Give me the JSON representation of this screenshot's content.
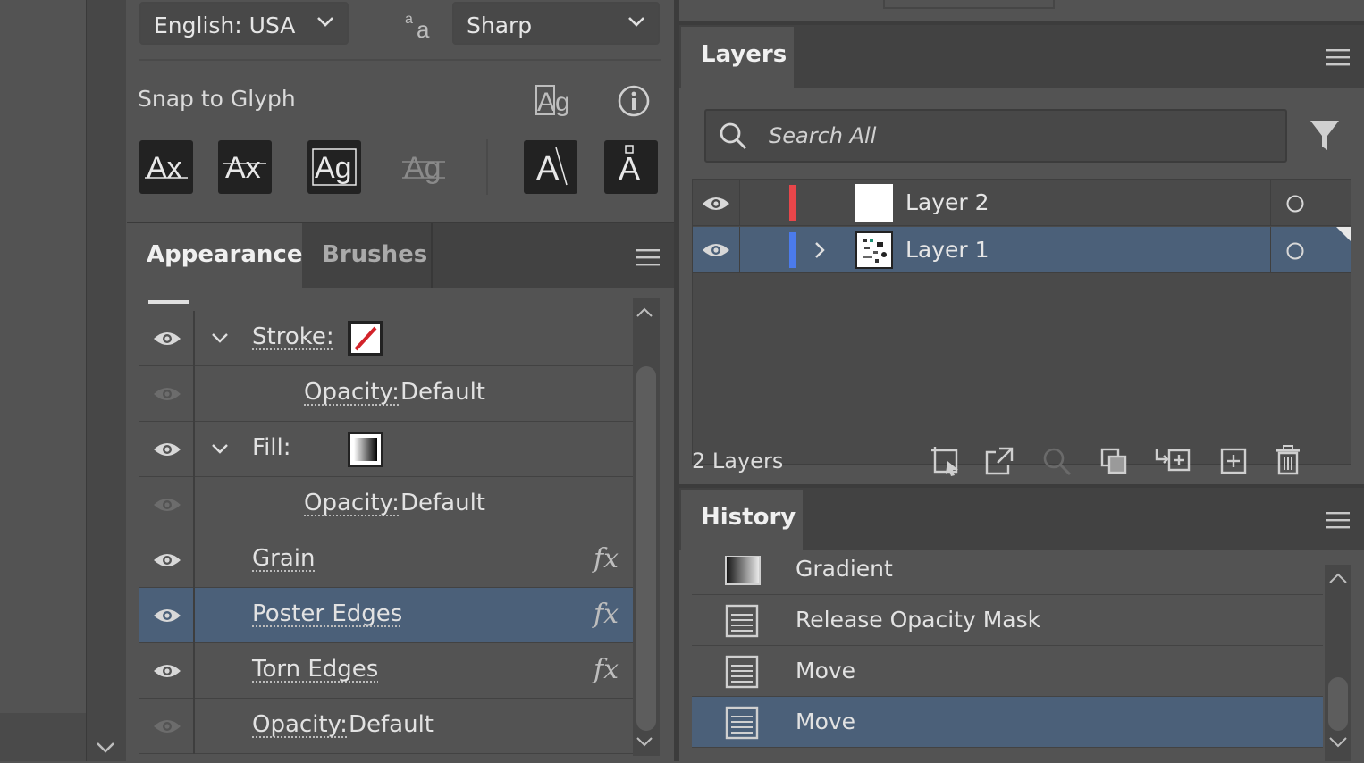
{
  "character": {
    "language": "English: USA",
    "antialias_icon": "aa-glyph-icon",
    "antialias": "Sharp",
    "snap_label": "Snap to Glyph",
    "glyph_buttons": [
      "Ax",
      "Ax",
      "Ag",
      "Ag",
      "A",
      "Å"
    ]
  },
  "appearance": {
    "tabs": [
      "Appearance",
      "Brushes"
    ],
    "rows": [
      {
        "label": "Stroke:",
        "type": "stroke"
      },
      {
        "label": "Opacity:",
        "value": "Default"
      },
      {
        "label": "Fill:",
        "type": "fill"
      },
      {
        "label": "Opacity:",
        "value": "Default"
      },
      {
        "label": "Grain",
        "fx": "fx"
      },
      {
        "label": "Poster Edges",
        "fx": "fx",
        "selected": true
      },
      {
        "label": "Torn Edges",
        "fx": "fx"
      },
      {
        "label": "Opacity:",
        "value": "Default"
      }
    ]
  },
  "layers": {
    "title": "Layers",
    "search_placeholder": "Search All",
    "items": [
      {
        "name": "Layer 2",
        "color": "#e8464a"
      },
      {
        "name": "Layer 1",
        "color": "#4b7bec",
        "selected": true
      }
    ],
    "count": "2 Layers"
  },
  "history": {
    "title": "History",
    "items": [
      "Gradient",
      "Release Opacity Mask",
      "Move",
      "Move"
    ]
  },
  "colors": {
    "panel": "#535353",
    "selection": "#4b6079"
  }
}
